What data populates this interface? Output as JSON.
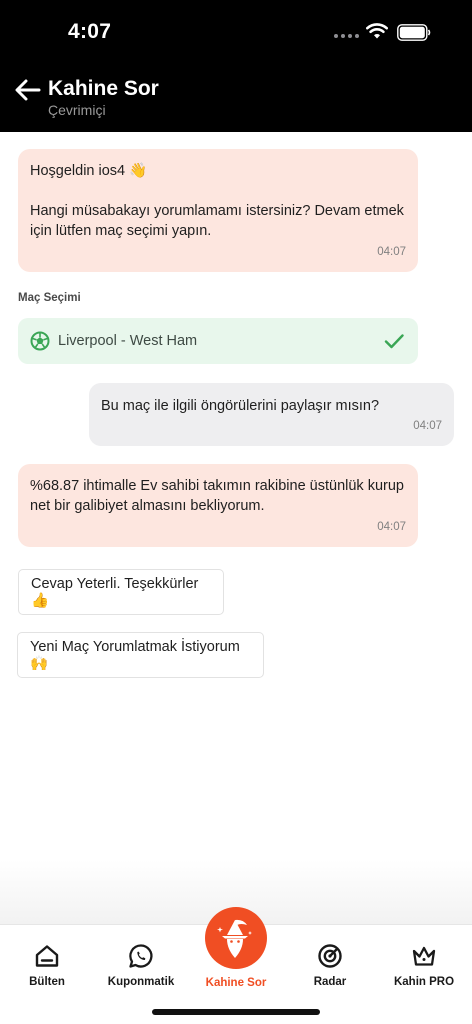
{
  "status_bar": {
    "time": "4:07"
  },
  "header": {
    "title": "Kahine Sor",
    "subtitle": "Çevrimiçi"
  },
  "chat": {
    "welcome": {
      "greeting": "Hoşgeldin ios4 👋",
      "prompt": "Hangi müsabakayı yorumlamamı istersiniz? Devam etmek için lütfen maç seçimi yapın.",
      "time": "04:07"
    },
    "match_section_label": "Maç Seçimi",
    "selected_match": {
      "label": "Liverpool - West Ham",
      "selected": true
    },
    "user_message": {
      "text": "Bu maç ile ilgili öngörülerini paylaşır mısın?",
      "time": "04:07"
    },
    "prediction": {
      "text": "%68.87 ihtimalle Ev sahibi takımın rakibine üstünlük kurup net bir galibiyet almasını bekliyorum.",
      "time": "04:07"
    },
    "quick_replies": [
      {
        "label": "Cevap Yeterli. Teşekkürler 👍"
      },
      {
        "label": "Yeni Maç Yorumlatmak İstiyorum 🙌"
      }
    ]
  },
  "tabbar": {
    "items": [
      {
        "label": "Bülten",
        "icon": "home-icon"
      },
      {
        "label": "Kuponmatik",
        "icon": "whatsapp-icon"
      },
      {
        "label": "Kahine Sor",
        "icon": "wizard-icon",
        "active": true
      },
      {
        "label": "Radar",
        "icon": "radar-icon"
      },
      {
        "label": "Kahin PRO",
        "icon": "crown-icon"
      }
    ]
  },
  "colors": {
    "accent": "#f04e23",
    "bot_bubble": "#fde6df",
    "user_bubble": "#eeeef0",
    "match_selected": "#e8f7ec",
    "check": "#3aa655"
  }
}
